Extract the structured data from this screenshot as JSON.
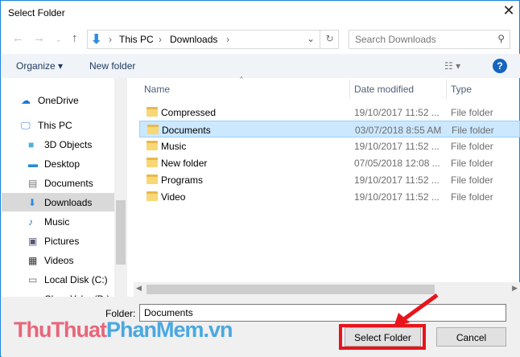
{
  "window": {
    "title": "Select Folder"
  },
  "address": {
    "crumbs": [
      "This PC",
      "Downloads"
    ],
    "search_placeholder": "Search Downloads"
  },
  "toolbar": {
    "organize": "Organize",
    "new_folder": "New folder"
  },
  "nav": [
    "OneDrive",
    "This PC",
    "3D Objects",
    "Desktop",
    "Documents",
    "Downloads",
    "Music",
    "Pictures",
    "Videos",
    "Local Disk (C:)",
    "ChamYoko (D:)"
  ],
  "columns": {
    "name": "Name",
    "date": "Date modified",
    "type": "Type"
  },
  "files": [
    {
      "name": "Compressed",
      "date": "19/10/2017 11:52 ...",
      "type": "File folder"
    },
    {
      "name": "Documents",
      "date": "03/07/2018 8:55 AM",
      "type": "File folder"
    },
    {
      "name": "Music",
      "date": "19/10/2017 11:52 ...",
      "type": "File folder"
    },
    {
      "name": "New folder",
      "date": "07/05/2018 12:08 ...",
      "type": "File folder"
    },
    {
      "name": "Programs",
      "date": "19/10/2017 11:52 ...",
      "type": "File folder"
    },
    {
      "name": "Video",
      "date": "19/10/2017 11:52 ...",
      "type": "File folder"
    }
  ],
  "footer": {
    "folder_label": "Folder:",
    "folder_value": "Documents",
    "select": "Select Folder",
    "cancel": "Cancel"
  },
  "watermark": {
    "part1": "ThuThuat",
    "part2": "PhanMem.vn"
  }
}
